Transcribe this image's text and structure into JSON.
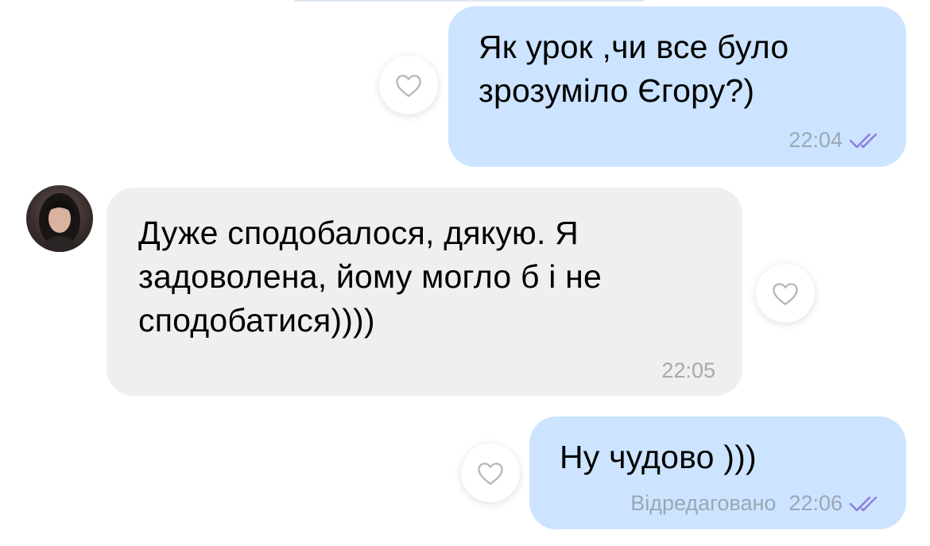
{
  "messages": [
    {
      "direction": "outgoing",
      "text": "Як урок ,чи все було\nзрозуміло Єгору?)",
      "time": "22:04",
      "read_icon": "double-check-icon"
    },
    {
      "direction": "incoming",
      "text": "Дуже сподобалося, дякую. Я\nзадоволена, йому могло б і не\nсподобатися))))",
      "time": "22:05",
      "avatar": "avatar"
    },
    {
      "direction": "outgoing",
      "text": "Ну чудово )))",
      "edited_label": "Відредаговано",
      "time": "22:06",
      "read_icon": "double-check-icon"
    }
  ],
  "like_icon": "heart-outline-icon",
  "colors": {
    "outgoing_bubble": "#cce4ff",
    "incoming_bubble": "#efefef",
    "meta_outgoing": "#9aa7b6",
    "read_check": "#8c7de0"
  }
}
